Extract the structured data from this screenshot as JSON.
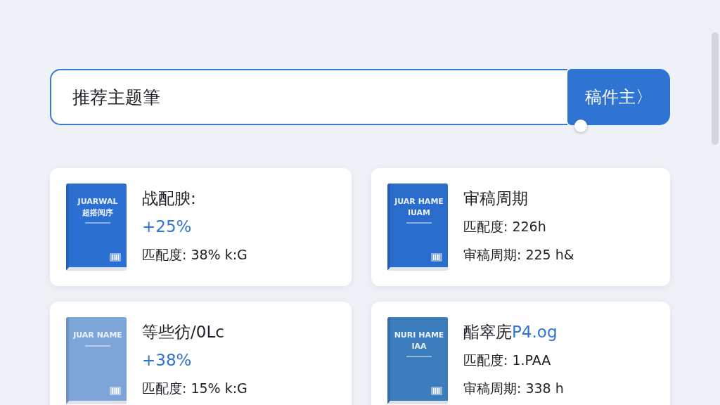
{
  "search": {
    "value": "推荐主题筆",
    "button": "稿件主〉"
  },
  "cards": [
    {
      "cover": {
        "color": "#2b6fd1",
        "lines": [
          "JUARWAL",
          "超搭阅序"
        ]
      },
      "lines": [
        {
          "kind": "title",
          "text": "战配腴:"
        },
        {
          "kind": "delta",
          "text": "+25%"
        },
        {
          "kind": "stat",
          "text": "匹配度: 38% k:G"
        }
      ]
    },
    {
      "cover": {
        "color": "#2a6ccc",
        "lines": [
          "JUAR HAME",
          "IUAM"
        ]
      },
      "lines": [
        {
          "kind": "title",
          "text": "审稿周期"
        },
        {
          "kind": "stat",
          "text": "匹配度: 226h"
        },
        {
          "kind": "stat",
          "text": "审稿周期: 225 h&"
        }
      ]
    },
    {
      "cover": {
        "color": "#7ea5d8",
        "lines": [
          "JUAR NAME"
        ]
      },
      "lines": [
        {
          "kind": "title",
          "text": "等些彷/0Lc"
        },
        {
          "kind": "delta",
          "text": "+38%"
        },
        {
          "kind": "stat",
          "text": "匹配度: 15% k:G"
        }
      ]
    },
    {
      "cover": {
        "color": "#3b7dbd",
        "lines": [
          "NURI HAME",
          "IAA"
        ]
      },
      "lines": [
        {
          "kind": "title",
          "text": "酯窣庑",
          "accent": "P4.og"
        },
        {
          "kind": "stat",
          "text": "匹配度: 1.PAA"
        },
        {
          "kind": "stat",
          "text": "审稿周期: 338 h"
        }
      ]
    }
  ]
}
